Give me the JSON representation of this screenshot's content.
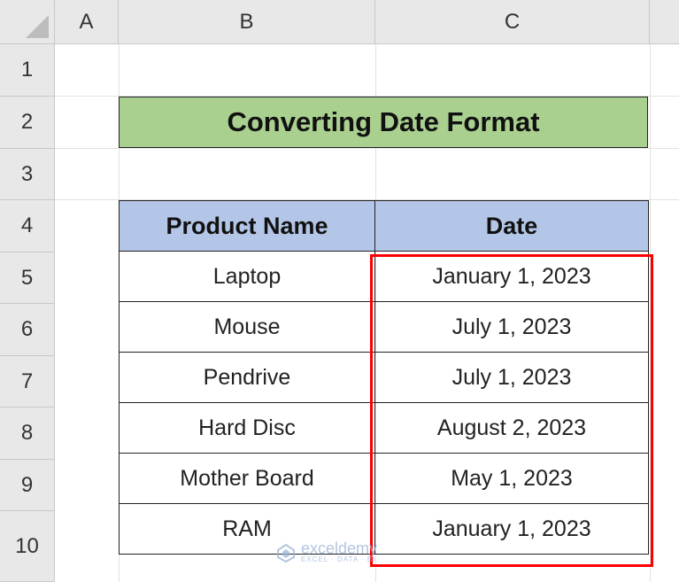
{
  "column_headers": [
    "A",
    "B",
    "C"
  ],
  "row_headers": [
    "1",
    "2",
    "3",
    "4",
    "5",
    "6",
    "7",
    "8",
    "9",
    "10"
  ],
  "title": "Converting Date Format",
  "table": {
    "headers": [
      "Product Name",
      "Date"
    ],
    "rows": [
      {
        "product": "Laptop",
        "date": "January 1, 2023"
      },
      {
        "product": "Mouse",
        "date": "July 1, 2023"
      },
      {
        "product": "Pendrive",
        "date": "July 1, 2023"
      },
      {
        "product": "Hard Disc",
        "date": "August 2, 2023"
      },
      {
        "product": "Mother Board",
        "date": "May 1, 2023"
      },
      {
        "product": "RAM",
        "date": "January 1, 2023"
      }
    ]
  },
  "watermark": {
    "name": "exceldemy",
    "tagline": "EXCEL · DATA · BI"
  },
  "colors": {
    "title_fill": "#a9d08e",
    "header_fill": "#b4c6e7",
    "highlight_border": "#ff0000",
    "sheet_header_fill": "#e8e8e8"
  }
}
